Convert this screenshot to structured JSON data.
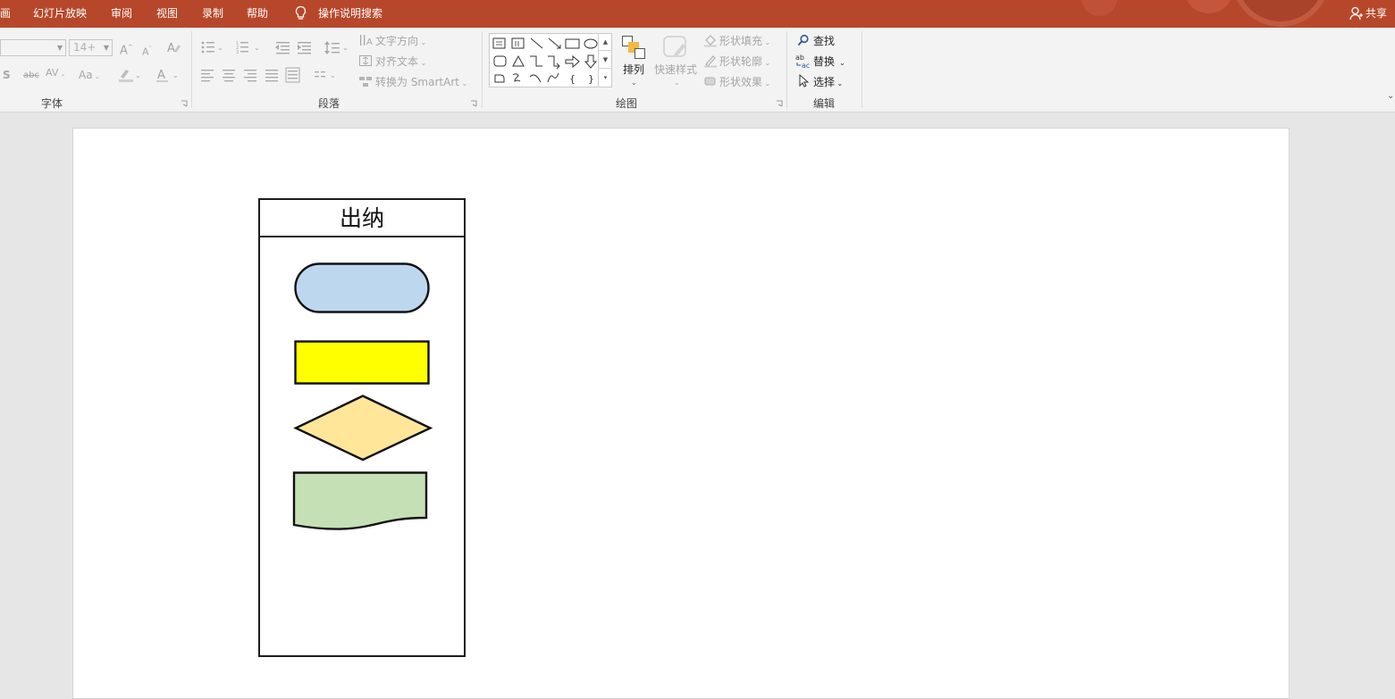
{
  "tabs": [
    {
      "label": "画"
    },
    {
      "label": "幻灯片放映"
    },
    {
      "label": "审阅"
    },
    {
      "label": "视图"
    },
    {
      "label": "录制"
    },
    {
      "label": "帮助"
    },
    {
      "label": "操作说明搜索"
    }
  ],
  "share_label": "共享",
  "font_group": {
    "label": "字体",
    "font_size": "14+",
    "font_name": ""
  },
  "paragraph_group": {
    "label": "段落",
    "text_direction": "文字方向",
    "align_text": "对齐文本",
    "convert_smartart": "转换为 SmartArt"
  },
  "drawing_group": {
    "label": "绘图",
    "arrange": "排列",
    "quick_styles": "快速样式",
    "shape_fill": "形状填充",
    "shape_outline": "形状轮廓",
    "shape_effects": "形状效果"
  },
  "editing_group": {
    "label": "编辑",
    "find": "查找",
    "replace": "替换",
    "select": "选择"
  },
  "slide": {
    "swimlane_title": "出纳",
    "shape_colors": {
      "terminator": "#bdd7ee",
      "process": "#ffff00",
      "decision": "#ffe699",
      "document": "#c5e0b4"
    }
  },
  "colors": {
    "accent": "#b7472a",
    "ribbon_bg": "#f3f3f3",
    "workspace_bg": "#e6e6e6"
  }
}
